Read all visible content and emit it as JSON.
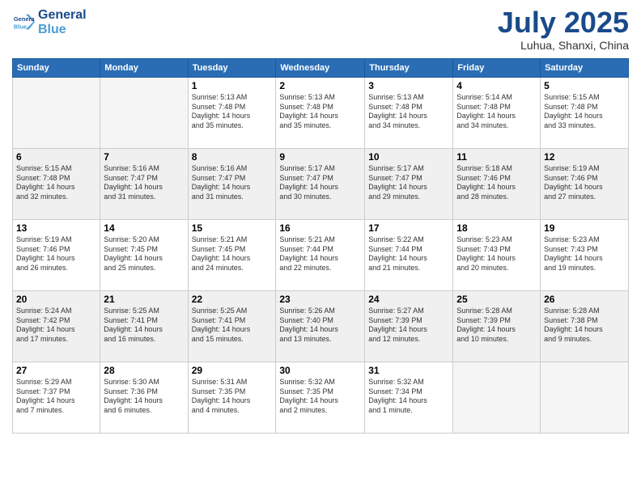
{
  "logo": {
    "line1": "General",
    "line2": "Blue"
  },
  "title": "July 2025",
  "location": "Luhua, Shanxi, China",
  "weekdays": [
    "Sunday",
    "Monday",
    "Tuesday",
    "Wednesday",
    "Thursday",
    "Friday",
    "Saturday"
  ],
  "rows": [
    [
      {
        "empty": true
      },
      {
        "empty": true
      },
      {
        "num": "1",
        "l1": "Sunrise: 5:13 AM",
        "l2": "Sunset: 7:48 PM",
        "l3": "Daylight: 14 hours",
        "l4": "and 35 minutes."
      },
      {
        "num": "2",
        "l1": "Sunrise: 5:13 AM",
        "l2": "Sunset: 7:48 PM",
        "l3": "Daylight: 14 hours",
        "l4": "and 35 minutes."
      },
      {
        "num": "3",
        "l1": "Sunrise: 5:13 AM",
        "l2": "Sunset: 7:48 PM",
        "l3": "Daylight: 14 hours",
        "l4": "and 34 minutes."
      },
      {
        "num": "4",
        "l1": "Sunrise: 5:14 AM",
        "l2": "Sunset: 7:48 PM",
        "l3": "Daylight: 14 hours",
        "l4": "and 34 minutes."
      },
      {
        "num": "5",
        "l1": "Sunrise: 5:15 AM",
        "l2": "Sunset: 7:48 PM",
        "l3": "Daylight: 14 hours",
        "l4": "and 33 minutes."
      }
    ],
    [
      {
        "num": "6",
        "l1": "Sunrise: 5:15 AM",
        "l2": "Sunset: 7:48 PM",
        "l3": "Daylight: 14 hours",
        "l4": "and 32 minutes."
      },
      {
        "num": "7",
        "l1": "Sunrise: 5:16 AM",
        "l2": "Sunset: 7:47 PM",
        "l3": "Daylight: 14 hours",
        "l4": "and 31 minutes."
      },
      {
        "num": "8",
        "l1": "Sunrise: 5:16 AM",
        "l2": "Sunset: 7:47 PM",
        "l3": "Daylight: 14 hours",
        "l4": "and 31 minutes."
      },
      {
        "num": "9",
        "l1": "Sunrise: 5:17 AM",
        "l2": "Sunset: 7:47 PM",
        "l3": "Daylight: 14 hours",
        "l4": "and 30 minutes."
      },
      {
        "num": "10",
        "l1": "Sunrise: 5:17 AM",
        "l2": "Sunset: 7:47 PM",
        "l3": "Daylight: 14 hours",
        "l4": "and 29 minutes."
      },
      {
        "num": "11",
        "l1": "Sunrise: 5:18 AM",
        "l2": "Sunset: 7:46 PM",
        "l3": "Daylight: 14 hours",
        "l4": "and 28 minutes."
      },
      {
        "num": "12",
        "l1": "Sunrise: 5:19 AM",
        "l2": "Sunset: 7:46 PM",
        "l3": "Daylight: 14 hours",
        "l4": "and 27 minutes."
      }
    ],
    [
      {
        "num": "13",
        "l1": "Sunrise: 5:19 AM",
        "l2": "Sunset: 7:46 PM",
        "l3": "Daylight: 14 hours",
        "l4": "and 26 minutes."
      },
      {
        "num": "14",
        "l1": "Sunrise: 5:20 AM",
        "l2": "Sunset: 7:45 PM",
        "l3": "Daylight: 14 hours",
        "l4": "and 25 minutes."
      },
      {
        "num": "15",
        "l1": "Sunrise: 5:21 AM",
        "l2": "Sunset: 7:45 PM",
        "l3": "Daylight: 14 hours",
        "l4": "and 24 minutes."
      },
      {
        "num": "16",
        "l1": "Sunrise: 5:21 AM",
        "l2": "Sunset: 7:44 PM",
        "l3": "Daylight: 14 hours",
        "l4": "and 22 minutes."
      },
      {
        "num": "17",
        "l1": "Sunrise: 5:22 AM",
        "l2": "Sunset: 7:44 PM",
        "l3": "Daylight: 14 hours",
        "l4": "and 21 minutes."
      },
      {
        "num": "18",
        "l1": "Sunrise: 5:23 AM",
        "l2": "Sunset: 7:43 PM",
        "l3": "Daylight: 14 hours",
        "l4": "and 20 minutes."
      },
      {
        "num": "19",
        "l1": "Sunrise: 5:23 AM",
        "l2": "Sunset: 7:43 PM",
        "l3": "Daylight: 14 hours",
        "l4": "and 19 minutes."
      }
    ],
    [
      {
        "num": "20",
        "l1": "Sunrise: 5:24 AM",
        "l2": "Sunset: 7:42 PM",
        "l3": "Daylight: 14 hours",
        "l4": "and 17 minutes."
      },
      {
        "num": "21",
        "l1": "Sunrise: 5:25 AM",
        "l2": "Sunset: 7:41 PM",
        "l3": "Daylight: 14 hours",
        "l4": "and 16 minutes."
      },
      {
        "num": "22",
        "l1": "Sunrise: 5:25 AM",
        "l2": "Sunset: 7:41 PM",
        "l3": "Daylight: 14 hours",
        "l4": "and 15 minutes."
      },
      {
        "num": "23",
        "l1": "Sunrise: 5:26 AM",
        "l2": "Sunset: 7:40 PM",
        "l3": "Daylight: 14 hours",
        "l4": "and 13 minutes."
      },
      {
        "num": "24",
        "l1": "Sunrise: 5:27 AM",
        "l2": "Sunset: 7:39 PM",
        "l3": "Daylight: 14 hours",
        "l4": "and 12 minutes."
      },
      {
        "num": "25",
        "l1": "Sunrise: 5:28 AM",
        "l2": "Sunset: 7:39 PM",
        "l3": "Daylight: 14 hours",
        "l4": "and 10 minutes."
      },
      {
        "num": "26",
        "l1": "Sunrise: 5:28 AM",
        "l2": "Sunset: 7:38 PM",
        "l3": "Daylight: 14 hours",
        "l4": "and 9 minutes."
      }
    ],
    [
      {
        "num": "27",
        "l1": "Sunrise: 5:29 AM",
        "l2": "Sunset: 7:37 PM",
        "l3": "Daylight: 14 hours",
        "l4": "and 7 minutes."
      },
      {
        "num": "28",
        "l1": "Sunrise: 5:30 AM",
        "l2": "Sunset: 7:36 PM",
        "l3": "Daylight: 14 hours",
        "l4": "and 6 minutes."
      },
      {
        "num": "29",
        "l1": "Sunrise: 5:31 AM",
        "l2": "Sunset: 7:35 PM",
        "l3": "Daylight: 14 hours",
        "l4": "and 4 minutes."
      },
      {
        "num": "30",
        "l1": "Sunrise: 5:32 AM",
        "l2": "Sunset: 7:35 PM",
        "l3": "Daylight: 14 hours",
        "l4": "and 2 minutes."
      },
      {
        "num": "31",
        "l1": "Sunrise: 5:32 AM",
        "l2": "Sunset: 7:34 PM",
        "l3": "Daylight: 14 hours",
        "l4": "and 1 minute."
      },
      {
        "empty": true
      },
      {
        "empty": true
      }
    ]
  ]
}
